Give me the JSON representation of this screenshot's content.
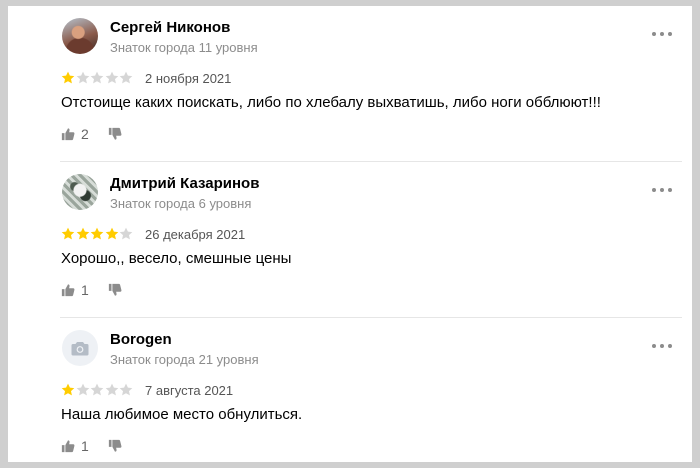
{
  "reviews": [
    {
      "author": "Сергей Никонов",
      "level": "Знаток города 11 уровня",
      "rating": 1,
      "date": "2 ноября 2021",
      "text": "Отстоище каких поискать, либо по хлебалу выхватишь, либо ноги обблюют!!!",
      "likes": "2",
      "avatar": "photo"
    },
    {
      "author": "Дмитрий Казаринов",
      "level": "Знаток города 6 уровня",
      "rating": 4,
      "date": "26 декабря 2021",
      "text": "Хорошо,, весело, смешные цены",
      "likes": "1",
      "avatar": "photo"
    },
    {
      "author": "Borogen",
      "level": "Знаток города 21 уровня",
      "rating": 1,
      "date": "7 августа 2021",
      "text": "Наша любимое место обнулиться.",
      "likes": "1",
      "avatar": "camera-icon"
    }
  ],
  "colors": {
    "star_filled": "#fc0",
    "star_empty": "#d6d6d6",
    "icon_gray": "#8c8c8c"
  },
  "icons": {
    "more": "more-dots-icon",
    "like": "thumbs-up-icon",
    "dislike": "thumbs-down-icon",
    "star": "star-icon"
  }
}
